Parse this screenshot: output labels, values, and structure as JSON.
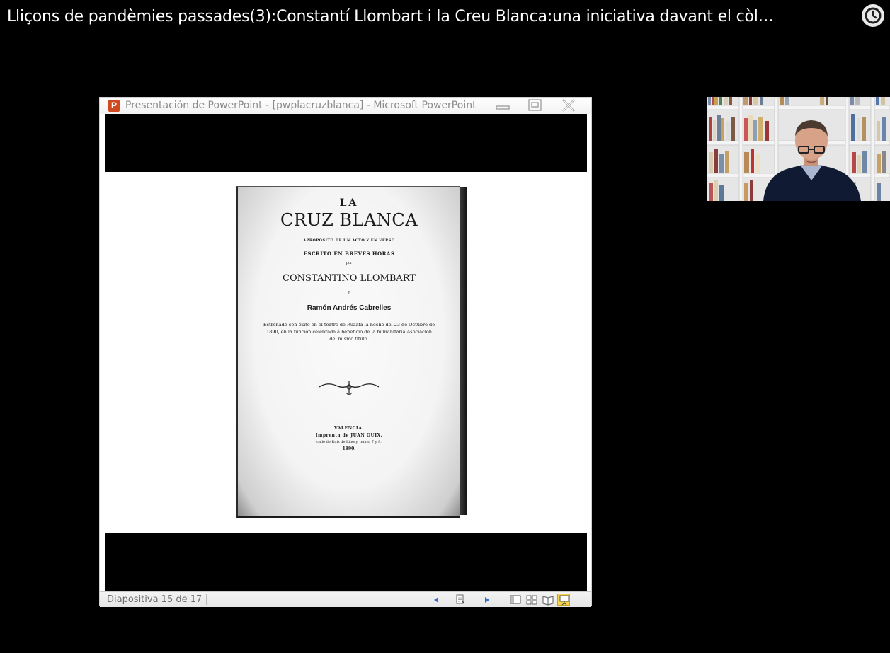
{
  "video": {
    "title": "Lliçons de pandèmies passades(3):Constantí Llombart i la Creu Blanca:una iniciativa davant el còl…",
    "watch_later_icon": "clock-icon"
  },
  "ppt_window": {
    "app_icon_letter": "P",
    "title": "Presentación de PowerPoint - [pwplacruzblanca] - Microsoft PowerPoint",
    "controls": [
      "minimize-icon",
      "maximize-icon",
      "close-icon"
    ]
  },
  "slide": {
    "book_cover": {
      "la": "LA",
      "title": "CRUZ BLANCA",
      "subtitle_line1": "APROPÓSITO DE UN ACTO Y EN VERSO",
      "subtitle_line2": "ESCRITO EN BREVES HORAS",
      "por": "por",
      "author1": "CONSTANTINO LLOMBART",
      "y": "y",
      "author2": "Ramón Andrés Cabrelles",
      "description": "Estrenado con éxito en el teatro de Ruzafa la noche del 23 de Octubre de 1890, en la función celebrada á beneficio de la humanitaria Asociación del mismo título.",
      "city": "VALENCIA.",
      "printer": "Imprenta de JUAN GUIX.",
      "street": "calle de Ruiz de Lihory, núms. 7 y 9.",
      "year": "1890."
    }
  },
  "statusbar": {
    "slide_counter": "Diapositiva 15 de 17",
    "icons": [
      "prev-slide-icon",
      "notes-icon",
      "next-slide-icon",
      "normal-view-icon",
      "slide-sorter-icon",
      "reading-view-icon",
      "slideshow-icon"
    ]
  },
  "webcam": {
    "icon": "presenter-video"
  },
  "colors": {
    "background": "#000000",
    "ppt_icon": "#d04a21",
    "slideshow_active": "#f7d64a"
  }
}
